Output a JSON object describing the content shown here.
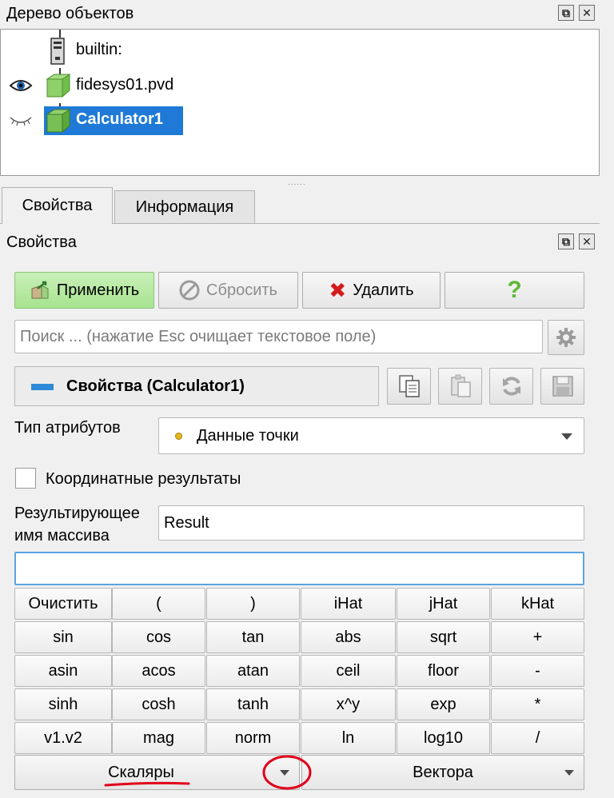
{
  "object_tree": {
    "title": "Дерево объектов",
    "items": [
      {
        "label": "builtin:",
        "icon": "server-icon"
      },
      {
        "label": "fidesys01.pvd",
        "icon": "green-cube-icon",
        "visible": true
      },
      {
        "label": "Calculator1",
        "icon": "green-cube-icon",
        "visible": false,
        "selected": true
      }
    ]
  },
  "tabs": [
    {
      "label": "Свойства",
      "active": true
    },
    {
      "label": "Информация",
      "active": false
    }
  ],
  "properties_panel": {
    "title": "Свойства",
    "apply_label": "Применить",
    "reset_label": "Сбросить",
    "delete_label": "Удалить",
    "help_label": "?",
    "search_placeholder": "Поиск ... (нажатие Esc очищает текстовое поле)",
    "section_title": "Свойства (Calculator1)"
  },
  "attribute_type": {
    "label": "Тип атрибутов",
    "value": "Данные точки"
  },
  "coordinate_results": {
    "label": "Координатные результаты",
    "checked": false
  },
  "result_array": {
    "label_line1": "Результирующее",
    "label_line2": "имя массива",
    "value": "Result"
  },
  "expression": {
    "value": ""
  },
  "calculator_buttons": [
    [
      "Очистить",
      "(",
      ")",
      "iHat",
      "jHat",
      "kHat"
    ],
    [
      "sin",
      "cos",
      "tan",
      "abs",
      "sqrt",
      "+"
    ],
    [
      "asin",
      "acos",
      "atan",
      "ceil",
      "floor",
      "-"
    ],
    [
      "sinh",
      "cosh",
      "tanh",
      "x^y",
      "exp",
      "*"
    ],
    [
      "v1.v2",
      "mag",
      "norm",
      "ln",
      "log10",
      "/"
    ]
  ],
  "dropdowns": {
    "scalars_label": "Скаляры",
    "vectors_label": "Вектора"
  },
  "colors": {
    "selection": "#1f7ad7",
    "apply_green": "#a7e38f",
    "annotation_red": "#e0001a"
  }
}
